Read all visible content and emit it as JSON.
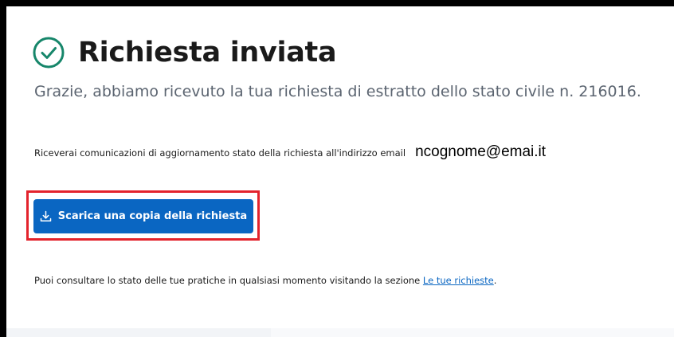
{
  "page": {
    "title": "Richiesta inviata",
    "title_icon": "check-circle-icon",
    "subtitle": "Grazie, abbiamo ricevuto la tua richiesta di estratto dello stato civile n. 216016.",
    "notification_text": "Riceverai comunicazioni di aggiornamento stato della richiesta all'indirizzo email",
    "email": "ncognome@emai.it",
    "download_button": {
      "label": "Scarica una copia della richiesta",
      "icon": "download-icon"
    },
    "footer": {
      "text": "Puoi consultare lo stato delle tue pratiche in qualsiasi momento visitando la sezione",
      "link_label": "Le tue richieste",
      "trailing": "."
    }
  },
  "colors": {
    "success": "#16866a",
    "primary": "#0a66c2",
    "highlight": "#e3232c",
    "muted_text": "#5b6470"
  }
}
